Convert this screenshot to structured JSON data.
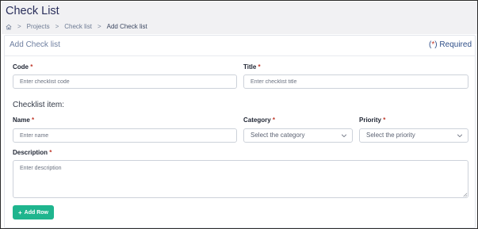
{
  "header": {
    "title": "Check List",
    "breadcrumb": {
      "home_icon": "home-icon",
      "separator": ">",
      "items": [
        "Projects",
        "Check list",
        "Add Check list"
      ]
    }
  },
  "card": {
    "title": "Add Check list",
    "required_note": {
      "open": "(",
      "star": "*",
      "close": ")",
      "text": " Required"
    }
  },
  "form": {
    "code": {
      "label": "Code",
      "star": "*",
      "placeholder": "Enter checklist code",
      "value": ""
    },
    "title": {
      "label": "Title",
      "star": "*",
      "placeholder": "Enter checklist title",
      "value": ""
    },
    "section_title": "Checklist item:",
    "name": {
      "label": "Name",
      "star": "*",
      "placeholder": "Enter name",
      "value": ""
    },
    "category": {
      "label": "Category",
      "star": "*",
      "selected": "Select the category"
    },
    "priority": {
      "label": "Priority",
      "star": "*",
      "selected": "Select the priority"
    },
    "description": {
      "label": "Description",
      "star": "*",
      "placeholder": "Enter description",
      "value": ""
    },
    "add_row_button": {
      "icon": "+",
      "label": "Add Row"
    }
  },
  "colors": {
    "accent_button": "#1fb58e",
    "title_text": "#2a2f5b",
    "required_star": "#c0392b"
  }
}
